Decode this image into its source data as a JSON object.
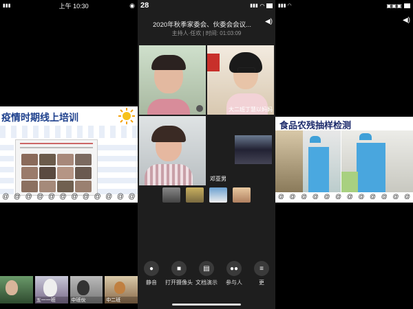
{
  "left": {
    "status_time": "上午 10:30",
    "slide_title": "疫情时期线上培训",
    "thumb_labels": [
      "",
      "五一一班",
      "中班伙",
      "中二班"
    ]
  },
  "center": {
    "status_time": "28",
    "meeting_title": "2020年秋季家委会、伙委会会议...",
    "meeting_subtitle": "主持人·任欢 | 时间: 01:03:09",
    "participants": [
      {
        "name": ""
      },
      {
        "name": "大二班丁慧以妈妈"
      },
      {
        "name": ""
      },
      {
        "name": "邓亚男"
      }
    ],
    "toolbar": [
      {
        "icon": "mic-off-icon",
        "label": "静音"
      },
      {
        "icon": "camera-off-icon",
        "label": "打开摄像头"
      },
      {
        "icon": "share-doc-icon",
        "label": "文档演示"
      },
      {
        "icon": "participants-icon",
        "label": "参与人"
      },
      {
        "icon": "more-icon",
        "label": "更"
      }
    ]
  },
  "right": {
    "slide_title": "食品农残抽样检测"
  },
  "colors": {
    "title_blue": "#1c3f8c",
    "meeting_bg": "#1e1e1e",
    "toolbar_icon_bg": "#3a3a3a"
  }
}
